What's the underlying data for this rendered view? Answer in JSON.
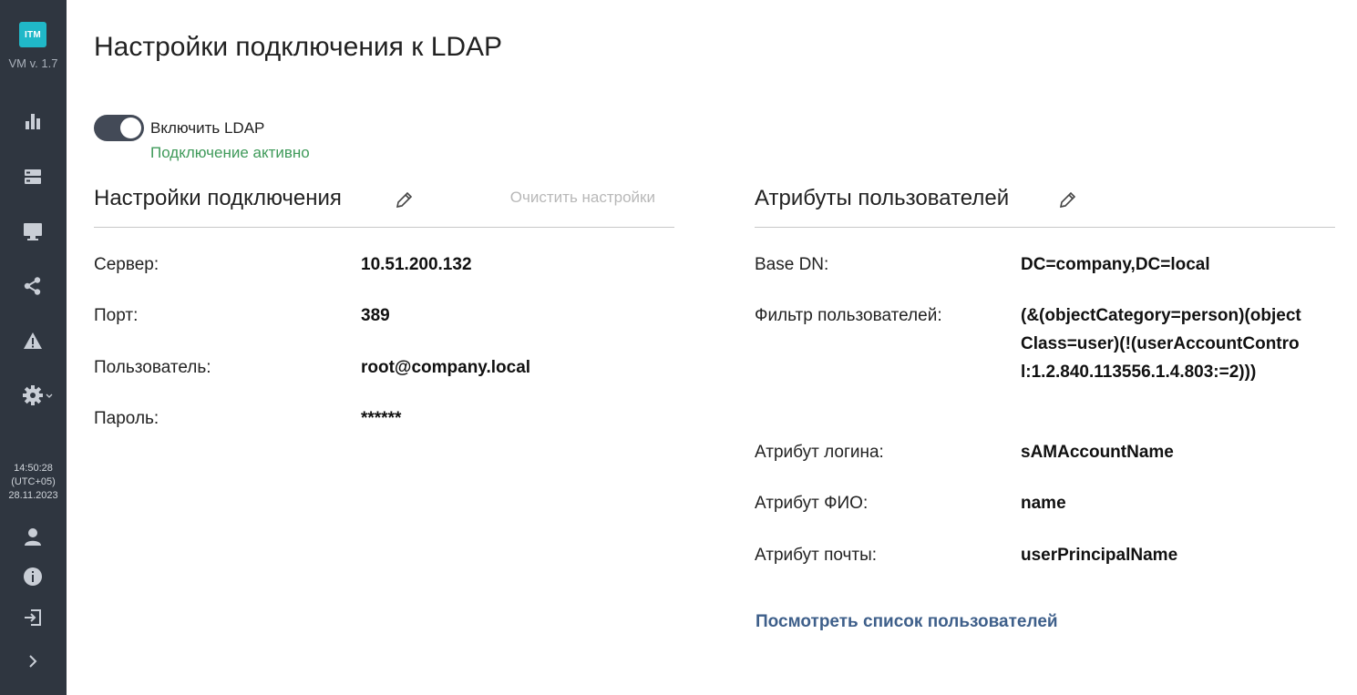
{
  "sidebar": {
    "logo_text": "ITM",
    "version": "VM v. 1.7",
    "clock_time": "14:50:28",
    "clock_tz": "(UTC+05)",
    "clock_date": "28.11.2023"
  },
  "page": {
    "title": "Настройки подключения к LDAP"
  },
  "ldap_toggle": {
    "label": "Включить LDAP",
    "enabled": true,
    "status": "Подключение активно"
  },
  "connection": {
    "title": "Настройки подключения",
    "clear_label": "Очистить настройки",
    "rows": [
      {
        "label": "Сервер:",
        "value": "10.51.200.132"
      },
      {
        "label": "Порт:",
        "value": "389"
      },
      {
        "label": "Пользователь:",
        "value": "root@company.local"
      },
      {
        "label": "Пароль:",
        "value": "******"
      }
    ]
  },
  "attributes": {
    "title": "Атрибуты пользователей",
    "rows": [
      {
        "label": "Base DN:",
        "value": "DC=company,DC=local"
      },
      {
        "label": "Фильтр пользователей:",
        "value": "(&(objectCategory=person)(objectClass=user)(!(userAccountControl:1.2.840.113556.1.4.803:=2)))"
      },
      {
        "label": "Атрибут логина:",
        "value": "sAMAccountName"
      },
      {
        "label": "Атрибут ФИО:",
        "value": "name"
      },
      {
        "label": "Атрибут почты:",
        "value": "userPrincipalName"
      }
    ],
    "users_link": "Посмотреть список пользователей"
  },
  "colors": {
    "sidebar_bg": "#2f3640",
    "logo_bg": "#20b8c8",
    "status_green": "#3f9a5a",
    "link_blue": "#3e5f8a",
    "toggle_on": "#434a57"
  }
}
